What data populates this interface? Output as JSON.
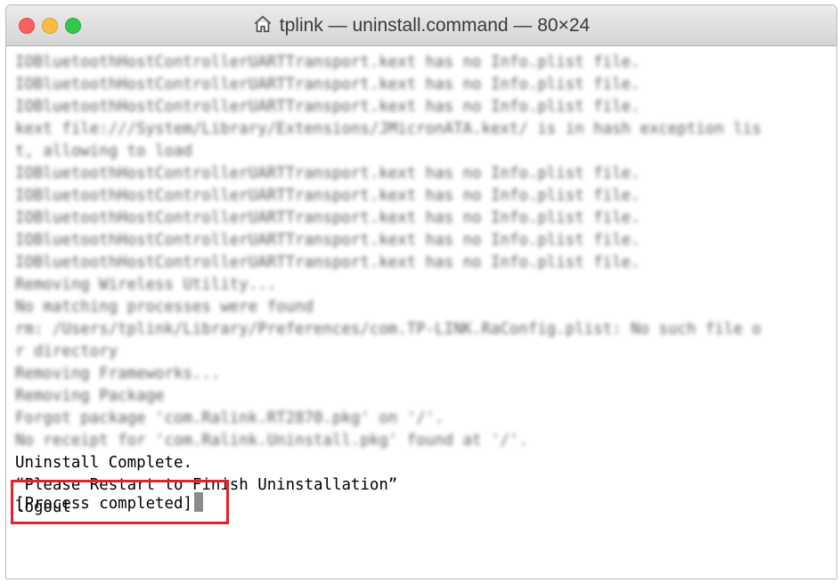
{
  "window": {
    "title": "tplink — uninstall.command — 80×24"
  },
  "terminal": {
    "blurred_lines": [
      "IOBluetoothHostControllerUARTTransport.kext has no Info.plist file.",
      "IOBluetoothHostControllerUARTTransport.kext has no Info.plist file.",
      "IOBluetoothHostControllerUARTTransport.kext has no Info.plist file.",
      "kext file:///System/Library/Extensions/JMicronATA.kext/ is in hash exception lis",
      "t, allowing to load",
      "IOBluetoothHostControllerUARTTransport.kext has no Info.plist file.",
      "IOBluetoothHostControllerUARTTransport.kext has no Info.plist file.",
      "IOBluetoothHostControllerUARTTransport.kext has no Info.plist file.",
      "IOBluetoothHostControllerUARTTransport.kext has no Info.plist file.",
      "IOBluetoothHostControllerUARTTransport.kext has no Info.plist file.",
      "Removing Wireless Utility...",
      "No matching processes were found",
      "rm: /Users/tplink/Library/Preferences/com.TP-LINK.RaConfig.plist: No such file o",
      "r directory",
      "Removing Frameworks...",
      "Removing Package",
      "Forgot package 'com.Ralink.RT2870.pkg' on '/'.",
      "No receipt for 'com.Ralink.Uninstall.pkg' found at '/'."
    ],
    "clear_lines": [
      "Uninstall Complete.",
      "“Please Restart to Finish Uninstallation”",
      "logout"
    ],
    "process_status": "[Process completed]"
  },
  "colors": {
    "highlight_border": "#e32229",
    "cursor": "#8b8b8b"
  }
}
